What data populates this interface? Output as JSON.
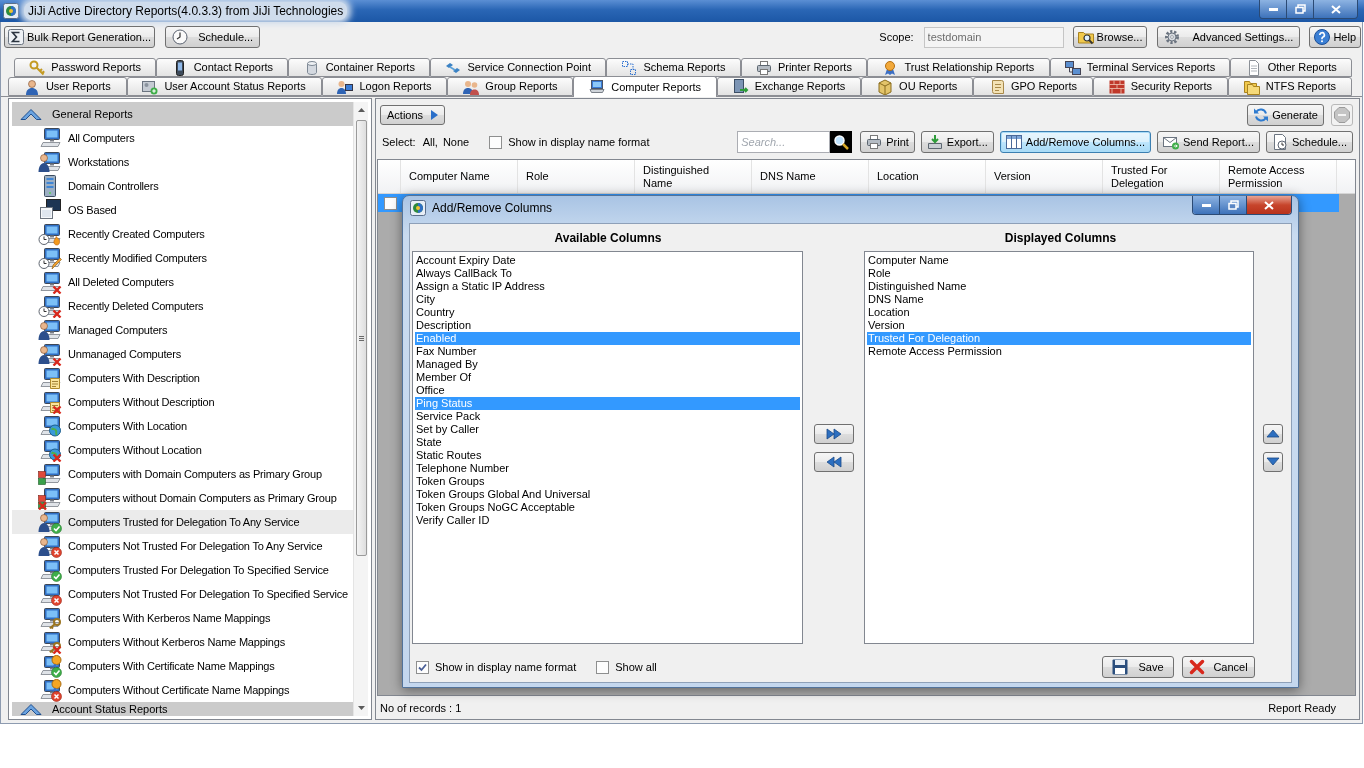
{
  "window": {
    "title": "JiJi Active Directory Reports(4.0.3.3) from JiJi Technologies"
  },
  "toolbar": {
    "buttons": [
      "Bulk Report Generation...",
      "Schedule..."
    ],
    "scope": {
      "label": "Scope:",
      "value": "testdomain",
      "disabled": true
    },
    "right_buttons": [
      "Browse...",
      "Advanced Settings...",
      "Help"
    ]
  },
  "tab_rows": [
    [
      {
        "label": "Password Reports",
        "selected": false
      },
      {
        "label": "Contact Reports",
        "selected": false
      },
      {
        "label": "Container Reports",
        "selected": false
      },
      {
        "label": "Service Connection Point",
        "selected": false
      },
      {
        "label": "Schema Reports",
        "selected": false
      },
      {
        "label": "Printer Reports",
        "selected": false
      },
      {
        "label": "Trust Relationship Reports",
        "selected": false
      },
      {
        "label": "Terminal Services Reports",
        "selected": false
      },
      {
        "label": "Other Reports",
        "selected": false
      }
    ],
    [
      {
        "label": "User Reports",
        "selected": false
      },
      {
        "label": "User Account Status Reports",
        "selected": false
      },
      {
        "label": "Logon Reports",
        "selected": false
      },
      {
        "label": "Group Reports",
        "selected": false
      },
      {
        "label": "Computer Reports",
        "selected": true
      },
      {
        "label": "Exchange Reports",
        "selected": false
      },
      {
        "label": "OU Reports",
        "selected": false
      },
      {
        "label": "GPO Reports",
        "selected": false
      },
      {
        "label": "Security Reports",
        "selected": false
      },
      {
        "label": "NTFS Reports",
        "selected": false
      }
    ]
  ],
  "sidebar": {
    "sections": [
      {
        "title": "General Reports",
        "expanded": true,
        "items": [
          {
            "label": "All Computers",
            "selected": false
          },
          {
            "label": "Workstations",
            "selected": false
          },
          {
            "label": "Domain Controllers",
            "selected": false
          },
          {
            "label": "OS Based",
            "selected": false
          },
          {
            "label": "Recently Created Computers",
            "selected": false
          },
          {
            "label": "Recently Modified Computers",
            "selected": false
          },
          {
            "label": "All Deleted Computers",
            "selected": false
          },
          {
            "label": "Recently Deleted Computers",
            "selected": false
          },
          {
            "label": "Managed Computers",
            "selected": false
          },
          {
            "label": "Unmanaged Computers",
            "selected": false
          },
          {
            "label": "Computers With Description",
            "selected": false
          },
          {
            "label": "Computers Without Description",
            "selected": false
          },
          {
            "label": "Computers With Location",
            "selected": false
          },
          {
            "label": "Computers Without Location",
            "selected": false
          },
          {
            "label": "Computers with Domain Computers as Primary Group",
            "selected": false
          },
          {
            "label": "Computers without Domain Computers as Primary Group",
            "selected": false
          },
          {
            "label": "Computers Trusted for Delegation To Any Service",
            "selected": true
          },
          {
            "label": "Computers Not Trusted For Delegation To Any Service",
            "selected": false
          },
          {
            "label": "Computers Trusted For Delegation To Specified Service",
            "selected": false
          },
          {
            "label": "Computers Not Trusted For Delegation To Specified Service",
            "selected": false
          },
          {
            "label": "Computers With Kerberos Name Mappings",
            "selected": false
          },
          {
            "label": "Computers Without Kerberos Name Mappings",
            "selected": false
          },
          {
            "label": "Computers With Certificate Name Mappings",
            "selected": false
          },
          {
            "label": "Computers Without Certificate Name Mappings",
            "selected": false
          }
        ]
      },
      {
        "title": "Account Status Reports",
        "expanded": true
      }
    ]
  },
  "report": {
    "actions": "Actions",
    "generate": "Generate",
    "stop": {
      "disabled": true
    },
    "select": {
      "label": "Select:",
      "links": [
        "All,",
        "None"
      ]
    },
    "display_name": {
      "label": "Show in display name format",
      "checked": false
    },
    "search": {
      "placeholder": "Search..."
    },
    "buttons": [
      {
        "label": "Print",
        "focused": false
      },
      {
        "label": "Export...",
        "focused": false
      },
      {
        "label": "Add/Remove Columns...",
        "focused": true
      },
      {
        "label": "Send Report...",
        "focused": false
      },
      {
        "label": "Schedule...",
        "focused": false
      }
    ]
  },
  "table": {
    "columns": [
      "Computer Name",
      "Role",
      "Distinguished Name",
      "DNS Name",
      "Location",
      "Version",
      "Trusted For Delegation",
      "Remote Access Permission"
    ],
    "rows": [
      {
        "selected": true,
        "checked": false
      }
    ]
  },
  "status_bar": {
    "records": "No of records : 1",
    "status": "Report Ready"
  },
  "dialog": {
    "title": "Add/Remove Columns",
    "available": {
      "heading": "Available Columns",
      "items": [
        {
          "label": "Account Expiry Date",
          "selected": false
        },
        {
          "label": "Always CallBack To",
          "selected": false
        },
        {
          "label": "Assign a Static IP Address",
          "selected": false
        },
        {
          "label": "City",
          "selected": false
        },
        {
          "label": "Country",
          "selected": false
        },
        {
          "label": "Description",
          "selected": false
        },
        {
          "label": "Enabled",
          "selected": true
        },
        {
          "label": "Fax Number",
          "selected": false
        },
        {
          "label": "Managed By",
          "selected": false
        },
        {
          "label": "Member Of",
          "selected": false
        },
        {
          "label": "Office",
          "selected": false
        },
        {
          "label": "Ping Status",
          "selected": true
        },
        {
          "label": "Service Pack",
          "selected": false
        },
        {
          "label": "Set by Caller",
          "selected": false
        },
        {
          "label": "State",
          "selected": false
        },
        {
          "label": "Static Routes",
          "selected": false
        },
        {
          "label": "Telephone Number",
          "selected": false
        },
        {
          "label": "Token Groups",
          "selected": false
        },
        {
          "label": "Token Groups Global And Universal",
          "selected": false
        },
        {
          "label": "Token Groups NoGC Acceptable",
          "selected": false
        },
        {
          "label": "Verify Caller ID",
          "selected": false
        }
      ]
    },
    "displayed": {
      "heading": "Displayed Columns",
      "items": [
        {
          "label": "Computer Name",
          "selected": false
        },
        {
          "label": "Role",
          "selected": false
        },
        {
          "label": "Distinguished Name",
          "selected": false
        },
        {
          "label": "DNS Name",
          "selected": false
        },
        {
          "label": "Location",
          "selected": false
        },
        {
          "label": "Version",
          "selected": false
        },
        {
          "label": "Trusted For Delegation",
          "selected": true
        },
        {
          "label": "Remote Access Permission",
          "selected": false
        }
      ]
    },
    "options": [
      {
        "label": "Show in display name format",
        "checked": true
      },
      {
        "label": "Show all",
        "checked": false
      }
    ],
    "buttons": [
      "Save",
      "Cancel"
    ]
  }
}
